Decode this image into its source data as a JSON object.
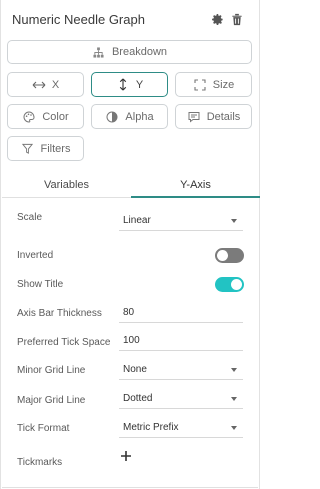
{
  "header": {
    "title": "Numeric Needle Graph",
    "settings_icon": "gear-icon",
    "delete_icon": "trash-icon"
  },
  "buttons": {
    "breakdown": "Breakdown",
    "x": "X",
    "y": "Y",
    "size": "Size",
    "color": "Color",
    "alpha": "Alpha",
    "details": "Details",
    "filters": "Filters"
  },
  "tabs": [
    {
      "label": "Variables",
      "active": false
    },
    {
      "label": "Y-Axis",
      "active": true
    }
  ],
  "settings": {
    "scale": {
      "label": "Scale",
      "value": "Linear"
    },
    "inverted": {
      "label": "Inverted",
      "on": false
    },
    "show_title": {
      "label": "Show Title",
      "on": true
    },
    "axis_bar_thickness": {
      "label": "Axis Bar Thickness",
      "value": "80"
    },
    "preferred_tick_space": {
      "label": "Preferred Tick Space",
      "value": "100"
    },
    "minor_grid_line": {
      "label": "Minor Grid Line",
      "value": "None"
    },
    "major_grid_line": {
      "label": "Major Grid Line",
      "value": "Dotted"
    },
    "tick_format": {
      "label": "Tick Format",
      "value": "Metric Prefix"
    },
    "tickmarks": {
      "label": "Tickmarks"
    }
  },
  "colors": {
    "accent": "#2e8c86",
    "toggle_on": "#22c3c3",
    "toggle_off": "#7b7b7b"
  }
}
